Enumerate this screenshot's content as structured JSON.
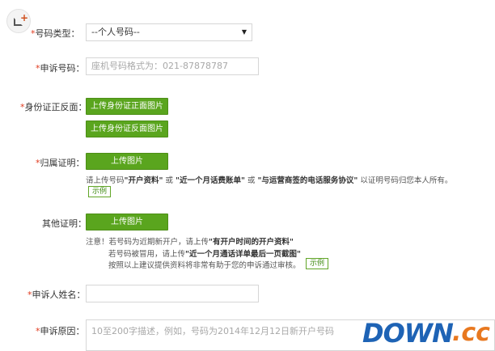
{
  "form": {
    "number_type": {
      "label": "号码类型：",
      "selected": "--个人号码--"
    },
    "appeal_number": {
      "label": "申诉号码：",
      "placeholder": "座机号码格式为：021-87878787"
    },
    "id_card": {
      "label": "身份证正反面：",
      "front_button": "上传身份证正面图片",
      "back_button": "上传身份证反面图片"
    },
    "ownership": {
      "label": "归属证明：",
      "upload_button": "上传图片",
      "note_prefix": "请上传号码",
      "note_doc1": "\"开户资料\"",
      "note_or1": "或",
      "note_doc2": "\"近一个月话费账单\"",
      "note_or2": "或",
      "note_doc3": "\"与运营商签的电话服务协议\"",
      "note_suffix": "以证明号码归您本人所有。",
      "example": "示例"
    },
    "other_proof": {
      "label": "其他证明：",
      "upload_button": "上传图片",
      "note1_prefix": "注意！若号码为近期新开户，请上传",
      "note1_doc": "\"有开户时间的开户资料\"",
      "note2_prefix": "若号码被冒用，请上传",
      "note2_doc": "\"近一个月通话详单最后一页截图\"",
      "note3": "按照以上建议提供资料将非常有助于您的申诉通过审核。",
      "example": "示例"
    },
    "appellant_name": {
      "label": "申诉人姓名："
    },
    "appeal_reason": {
      "label": "申诉原因：",
      "placeholder": "10至200字描述，例如，号码为2014年12月12日新开户号码"
    }
  },
  "watermark": {
    "brand": "DOWN",
    "tld": ".cc"
  },
  "colors": {
    "accent_green": "#5aa51e",
    "required_star": "#e03a1e",
    "watermark_blue": "#1e63b5",
    "watermark_orange": "#e8781f"
  },
  "icons": {
    "corner": "add-box-icon",
    "select_caret": "caret-down-icon"
  }
}
